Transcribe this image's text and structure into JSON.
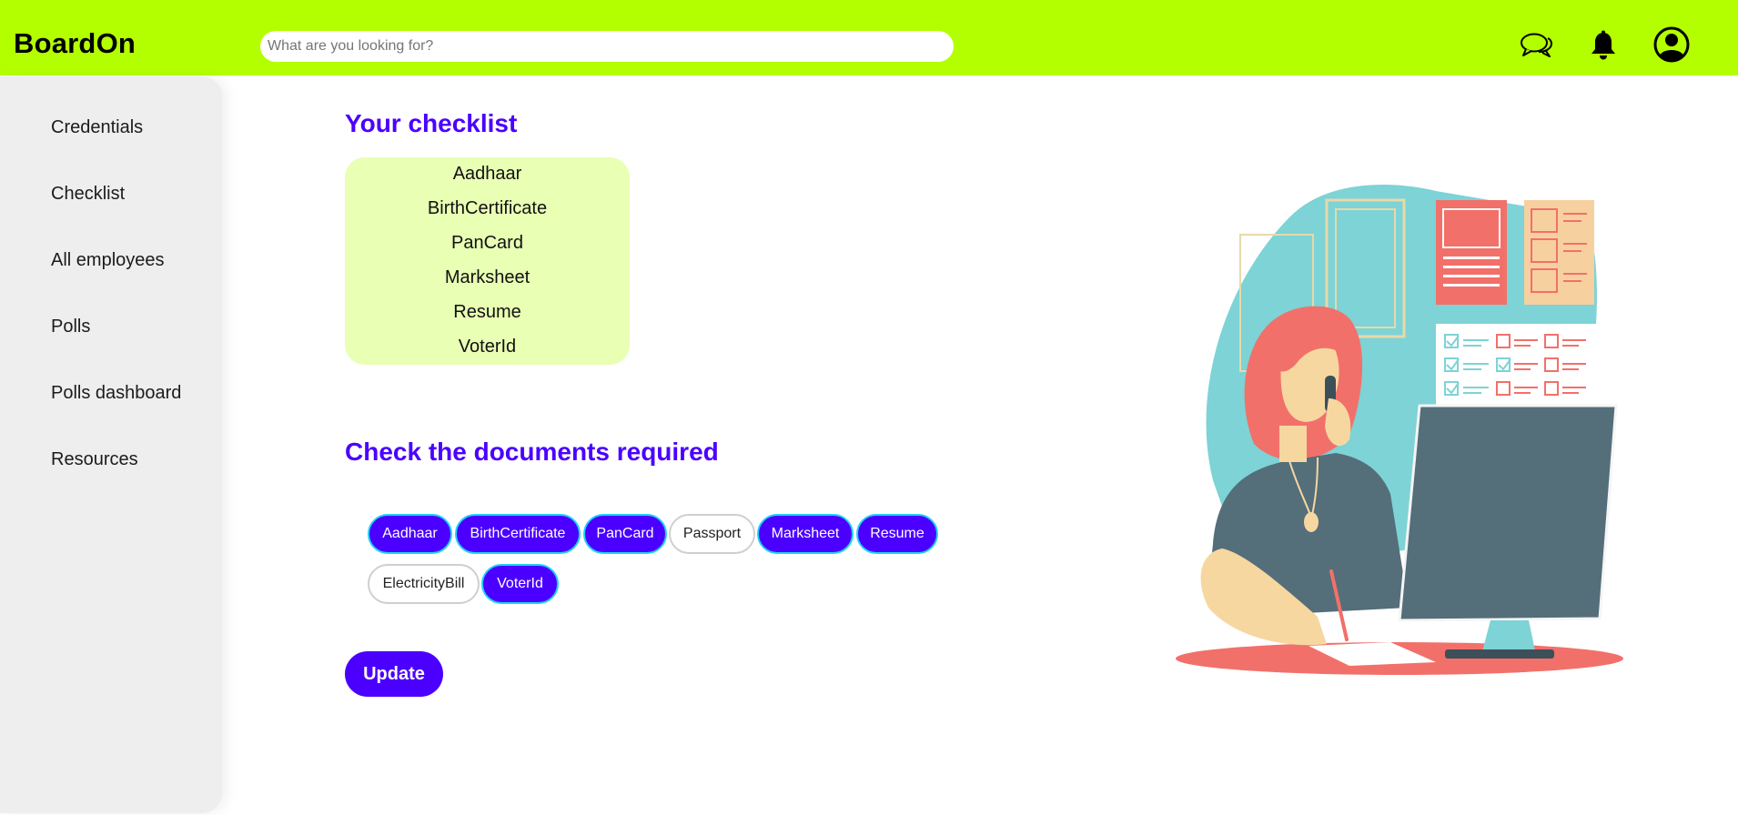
{
  "header": {
    "brand": "BoardOn",
    "search_placeholder": "What are you looking for?",
    "icons": [
      "chat-icon",
      "bell-icon",
      "user-avatar-icon"
    ]
  },
  "sidebar": {
    "items": [
      {
        "label": "Credentials"
      },
      {
        "label": "Checklist"
      },
      {
        "label": "All employees"
      },
      {
        "label": "Polls"
      },
      {
        "label": "Polls dashboard"
      },
      {
        "label": "Resources"
      }
    ]
  },
  "checklist": {
    "title": "Your checklist",
    "items": [
      "Aadhaar",
      "BirthCertificate",
      "PanCard",
      "Marksheet",
      "Resume",
      "VoterId"
    ]
  },
  "documents": {
    "title": "Check the documents required",
    "options": [
      {
        "label": "Aadhaar",
        "selected": true
      },
      {
        "label": "BirthCertificate",
        "selected": true
      },
      {
        "label": "PanCard",
        "selected": true
      },
      {
        "label": "Passport",
        "selected": false
      },
      {
        "label": "Marksheet",
        "selected": true
      },
      {
        "label": "Resume",
        "selected": true
      },
      {
        "label": "ElectricityBill",
        "selected": false
      },
      {
        "label": "VoterId",
        "selected": true
      }
    ]
  },
  "actions": {
    "update_label": "Update"
  },
  "colors": {
    "header_bg": "#b3ff00",
    "accent": "#4b00ff",
    "chip_border_selected": "#1fd2f5",
    "checklist_bg": "#e8ffb4",
    "sidebar_bg": "#eeeeee"
  }
}
